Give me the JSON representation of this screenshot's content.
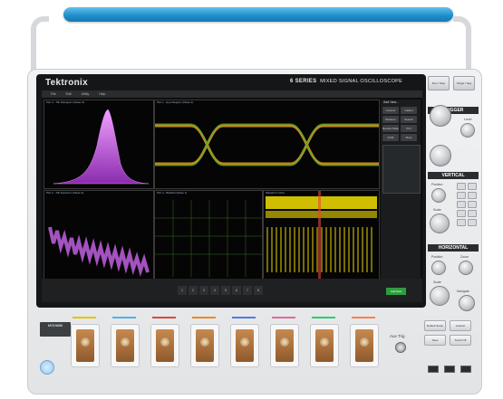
{
  "brand": "Tektronix",
  "model_series": "6 SERIES",
  "model_subtitle": "MIXED SIGNAL OSCILLOSCOPE",
  "menu": [
    "File",
    "Edit",
    "Utility",
    "Help"
  ],
  "panels": [
    {
      "title": "Plot 3 - TIE Histogram (Meas 3)"
    },
    {
      "title": "Plot 1 - Eye Diagram (Meas 1)"
    },
    {
      "title": "Plot 2 - TIE Spectrum (Meas 2)"
    },
    {
      "title": "Plot 4 - Bathtub (Meas 1)"
    },
    {
      "title": "Waveform View"
    }
  ],
  "side_buttons": [
    "Cursors",
    "Callout",
    "Measure",
    "Search",
    "Results Table",
    "Plot",
    "DVM",
    "More"
  ],
  "side_header": "Add New...",
  "channels": [
    "1",
    "2",
    "3",
    "4",
    "5",
    "6",
    "7",
    "8"
  ],
  "add_new_button": "Add New",
  "controls": {
    "run_stop": "Run / Stop",
    "single": "Single / Seq",
    "trigger": "TRIGGER",
    "level": "Level",
    "vertical": "VERTICAL",
    "position": "Position",
    "scale": "Scale",
    "horizontal": "HORIZONTAL",
    "zoom": "Zoom",
    "navigate": "Navigate"
  },
  "front": {
    "model_tag": "MSO68B",
    "aux_trig": "Aux Trig",
    "bottom_buttons": [
      "Default Setup",
      "Autoset",
      "Save",
      "Touch Off"
    ]
  },
  "colors": {
    "handle": "#1f8cc9",
    "histogram": "#c040e0",
    "eye": "#e0a020",
    "spectrum": "#c060e0",
    "bathtub": "#4e8c2f",
    "waveform": "#e6d400",
    "ch1": "#e6c200",
    "ch2": "#4fb3e8",
    "ch3": "#e0473a",
    "ch4": "#ef8a1e",
    "ch5": "#4f7be8",
    "ch6": "#e06aa0",
    "ch7": "#2ecc71",
    "ch8": "#ff7f50"
  }
}
